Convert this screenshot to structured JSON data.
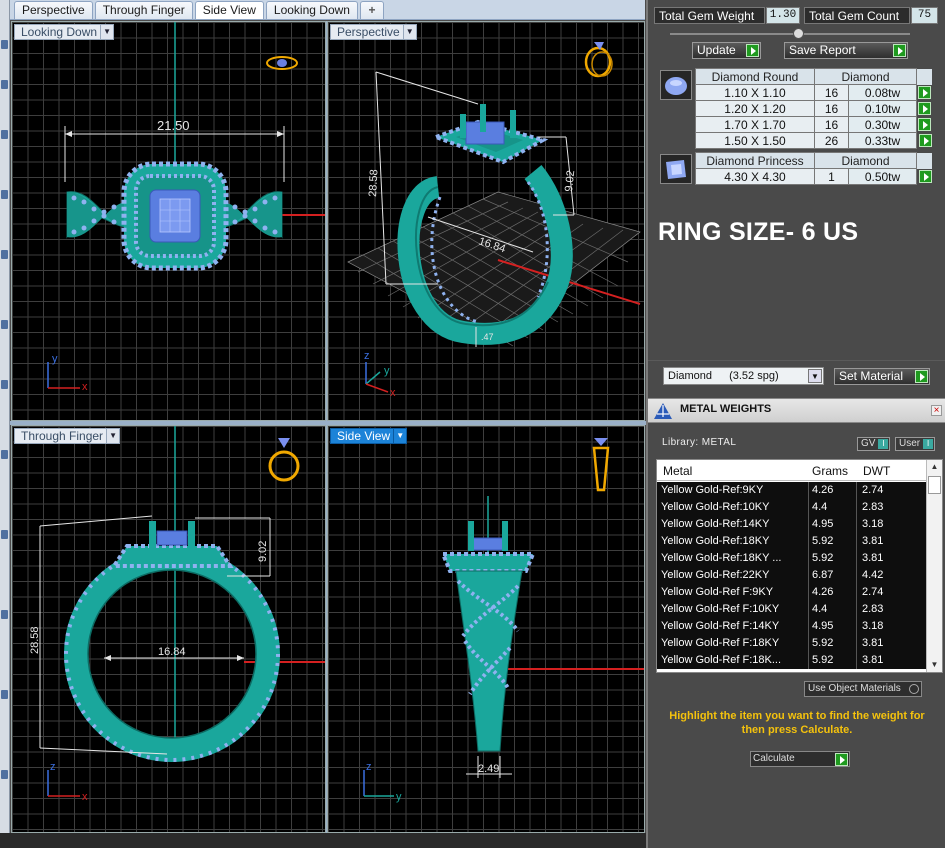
{
  "tabs": [
    {
      "label": "Perspective",
      "active": false
    },
    {
      "label": "Through Finger",
      "active": false
    },
    {
      "label": "Side View",
      "active": true
    },
    {
      "label": "Looking Down",
      "active": false
    }
  ],
  "add_tab_glyph": "+",
  "viewports": {
    "top_left": {
      "label": "Looking Down",
      "dims": [
        "21.50"
      ],
      "axes": [
        "y",
        "x"
      ]
    },
    "top_right": {
      "label": "Perspective",
      "dims": [
        "28.58",
        "9.02",
        "16.84",
        ".47"
      ],
      "axes": [
        "z",
        "y",
        "x"
      ]
    },
    "bottom_left": {
      "label": "Through Finger",
      "dims": [
        "28.58",
        "9.02",
        "16.84"
      ],
      "axes": [
        "z",
        "x"
      ]
    },
    "bottom_right": {
      "label": "Side View",
      "dims": [
        "2.49"
      ],
      "axes": [
        "z",
        "y"
      ]
    }
  },
  "totals": {
    "weight_label": "Total Gem Weight",
    "weight_value": "1.30",
    "count_label": "Total Gem Count",
    "count_value": "75"
  },
  "buttons": {
    "update": "Update",
    "save_report": "Save Report",
    "set_material": "Set Material",
    "calculate": "Calculate"
  },
  "gems": {
    "round": {
      "header": "Diamond Round",
      "material": "Diamond",
      "rows": [
        {
          "size": "1.10 X 1.10",
          "count": "16",
          "tw": "0.08tw"
        },
        {
          "size": "1.20 X 1.20",
          "count": "16",
          "tw": "0.10tw"
        },
        {
          "size": "1.70 X 1.70",
          "count": "16",
          "tw": "0.30tw"
        },
        {
          "size": "1.50 X 1.50",
          "count": "26",
          "tw": "0.33tw"
        }
      ]
    },
    "princess": {
      "header": "Diamond Princess",
      "material": "Diamond",
      "rows": [
        {
          "size": "4.30 X 4.30",
          "count": "1",
          "tw": "0.50tw"
        }
      ]
    }
  },
  "ring_size": "RING SIZE- 6 US",
  "material_select": {
    "name": "Diamond",
    "spg": "(3.52 spg)"
  },
  "metal_weights": {
    "title": "METAL WEIGHTS",
    "close_glyph": "×",
    "library": "Library: METAL",
    "toggle_gv": "GV",
    "toggle_user": "User",
    "toggle_indicator": "I",
    "columns": [
      "Metal",
      "Grams",
      "DWT"
    ],
    "rows": [
      [
        "Yellow Gold-Ref:9KY",
        "4.26",
        "2.74"
      ],
      [
        "Yellow Gold-Ref:10KY",
        "4.4",
        "2.83"
      ],
      [
        "Yellow Gold-Ref:14KY",
        "4.95",
        "3.18"
      ],
      [
        "Yellow Gold-Ref:18KY",
        "5.92",
        "3.81"
      ],
      [
        "Yellow Gold-Ref:18KY ...",
        "5.92",
        "3.81"
      ],
      [
        "Yellow Gold-Ref:22KY",
        "6.87",
        "4.42"
      ],
      [
        "Yellow Gold-Ref F:9KY",
        "4.26",
        "2.74"
      ],
      [
        "Yellow Gold-Ref F:10KY",
        "4.4",
        "2.83"
      ],
      [
        "Yellow Gold-Ref F:14KY",
        "4.95",
        "3.18"
      ],
      [
        "Yellow Gold-Ref F:18KY",
        "5.92",
        "3.81"
      ],
      [
        "Yellow Gold-Ref F:18K...",
        "5.92",
        "3.81"
      ]
    ],
    "use_object_materials": "Use Object Materials",
    "hint": "Highlight the item you want to find the weight for then press Calculate."
  },
  "colors": {
    "ring_teal": "#1aa79c",
    "gem_lilac": "#8fb2f0",
    "center_stone": "#4d6fd8",
    "dim_line": "#e6e6e6",
    "accent_red": "#d42020",
    "hint_yellow": "#f4c20d"
  }
}
